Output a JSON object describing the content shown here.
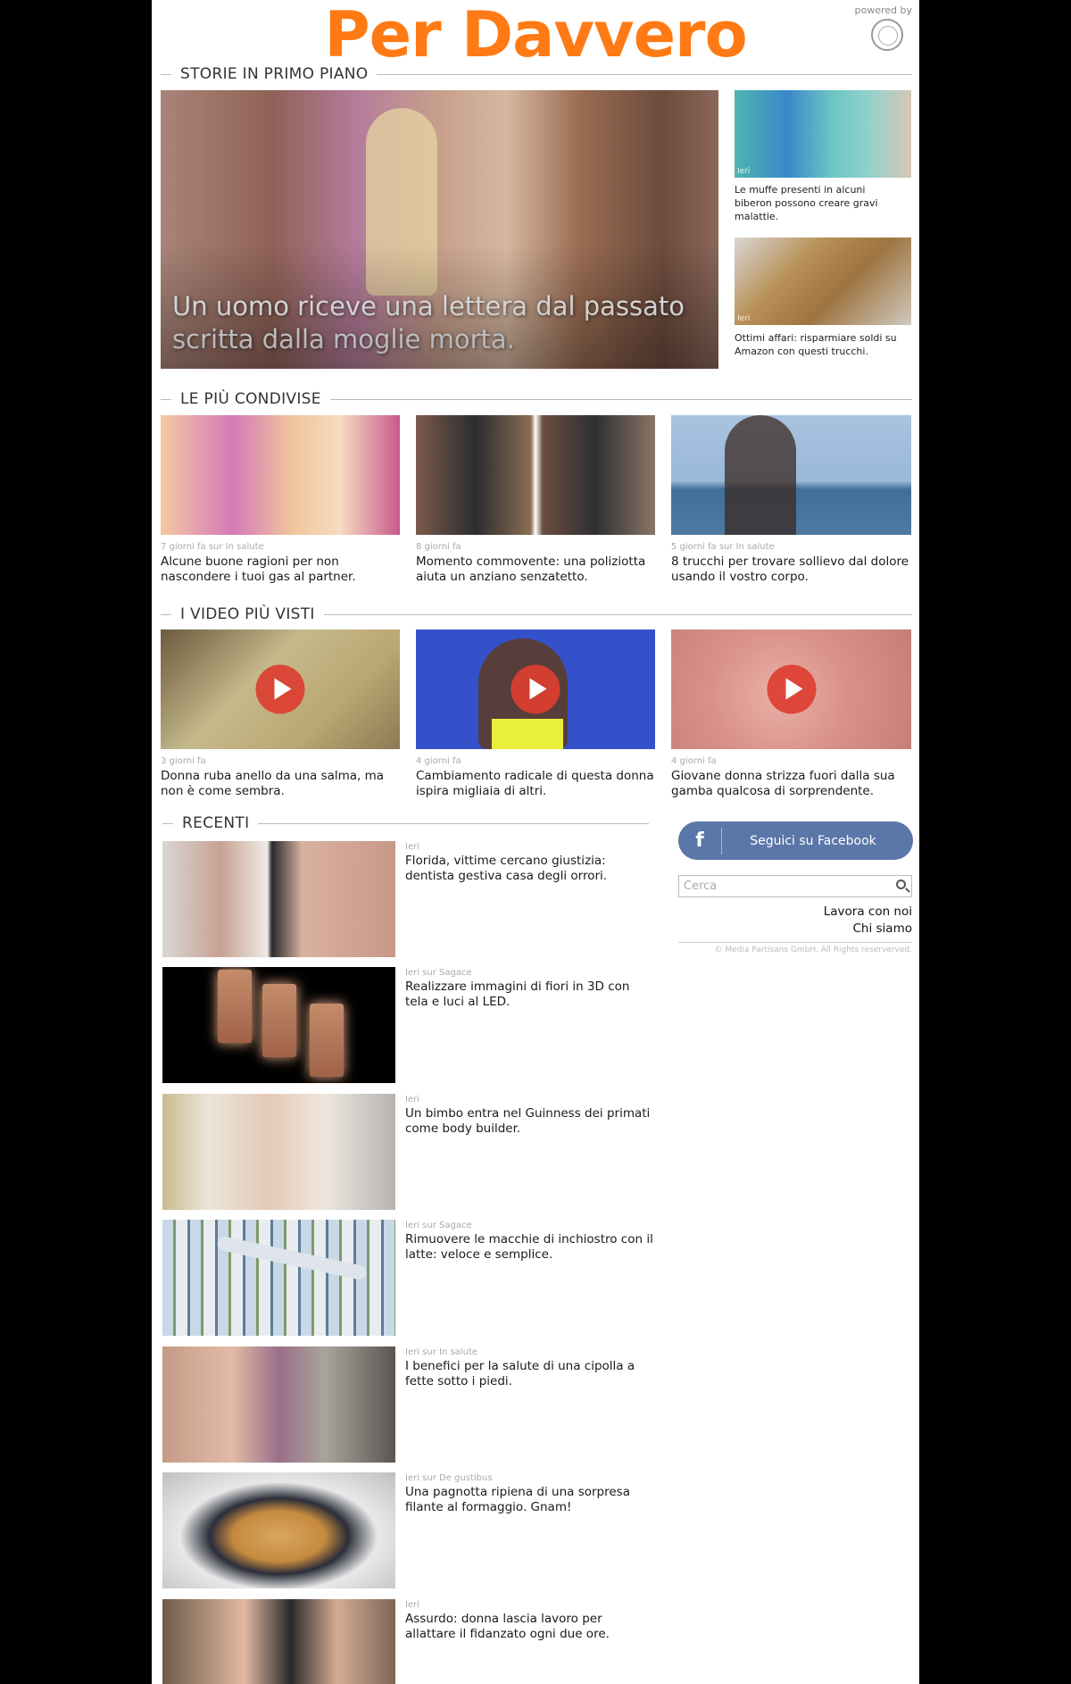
{
  "header": {
    "logo_text": "Per Davvero",
    "powered_by": "powered by"
  },
  "sections": {
    "featured": "STORIE IN PRIMO PIANO",
    "shared": "LE PIÙ CONDIVISE",
    "videos": "I VIDEO PIÙ VISTI",
    "recent": "RECENTI"
  },
  "featured": {
    "hero_title": "Un uomo riceve una lettera dal passato scritta dalla moglie morta.",
    "side": [
      {
        "stamp": "Ieri",
        "title": "Le muffe presenti in alcuni biberon possono creare gravi malattie."
      },
      {
        "stamp": "Ieri",
        "title": "Ottimi affari: risparmiare soldi su Amazon con questi trucchi."
      }
    ]
  },
  "shared": [
    {
      "meta": "7 giorni fa sur In salute",
      "title": "Alcune buone ragioni per non nascondere i tuoi gas al partner."
    },
    {
      "meta": "8 giorni fa",
      "title": "Momento commovente: una poliziotta aiuta un anziano senzatetto."
    },
    {
      "meta": "5 giorni fa sur In salute",
      "title": "8 trucchi per trovare sollievo dal dolore usando il vostro corpo."
    }
  ],
  "videos": [
    {
      "meta": "3 giorni fa",
      "title": "Donna ruba anello da una salma, ma non è come sembra."
    },
    {
      "meta": "4 giorni fa",
      "title": "Cambiamento radicale di questa donna ispira migliaia di altri."
    },
    {
      "meta": "4 giorni fa",
      "title": "Giovane donna strizza fuori dalla sua gamba qualcosa di sorprendente."
    }
  ],
  "recent": [
    {
      "meta": "Ieri",
      "title": "Florida, vittime cercano giustizia: dentista gestiva casa degli orrori."
    },
    {
      "meta": "Ieri sur Sagace",
      "title": "Realizzare immagini di fiori in 3D con tela e luci al LED."
    },
    {
      "meta": "Ieri",
      "title": "Un bimbo entra nel Guinness dei primati come body builder."
    },
    {
      "meta": "Ieri sur Sagace",
      "title": "Rimuovere le macchie di inchiostro con il latte: veloce e semplice."
    },
    {
      "meta": "Ieri sur In salute",
      "title": "I benefici per la salute di una cipolla a fette sotto i piedi."
    },
    {
      "meta": "Ieri sur De gustibus",
      "title": "Una pagnotta ripiena di una sorpresa filante al formaggio. Gnam!"
    },
    {
      "meta": "Ieri",
      "title": "Assurdo: donna lascia lavoro per allattare il fidanzato ogni due ore."
    }
  ],
  "sidebar": {
    "facebook_icon": "f",
    "facebook_label": "Seguici su Facebook",
    "search_placeholder": "Cerca",
    "link_work": "Lavora con noi",
    "link_about": "Chi siamo",
    "copyright": "© Media Partisans GmbH. All Rights reserverved."
  },
  "colors": {
    "logo": "#ff7a14",
    "facebook": "#5b76a8",
    "play_button": "#dc3e30"
  }
}
